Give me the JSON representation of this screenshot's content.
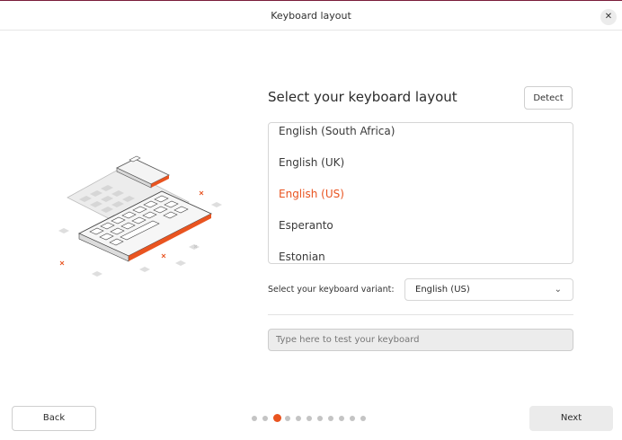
{
  "window": {
    "title": "Keyboard layout",
    "close_glyph": "✕"
  },
  "main": {
    "heading": "Select your keyboard layout",
    "detect_label": "Detect",
    "layouts": [
      {
        "label": "English (South Africa)",
        "selected": false
      },
      {
        "label": "English (UK)",
        "selected": false
      },
      {
        "label": "English (US)",
        "selected": true
      },
      {
        "label": "Esperanto",
        "selected": false
      },
      {
        "label": "Estonian",
        "selected": false
      }
    ],
    "variant_label": "Select your keyboard variant:",
    "variant_value": "English (US)",
    "test_placeholder": "Type here to test your keyboard"
  },
  "footer": {
    "back_label": "Back",
    "next_label": "Next",
    "pager": {
      "total": 11,
      "current": 3
    }
  },
  "colors": {
    "accent": "#e95420",
    "dot_inactive": "#c4c4c4"
  }
}
